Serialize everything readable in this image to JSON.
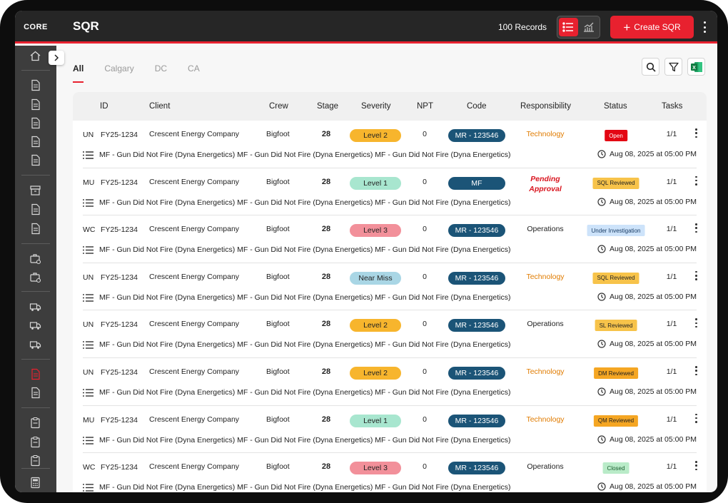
{
  "app": {
    "logo": "CORE",
    "title": "SQR",
    "records": "100 Records",
    "create_label": "Create SQR"
  },
  "colors": {
    "accent": "#e8212f",
    "topbar": "#262626",
    "sidebar": "#3d3d3d",
    "code_pill": "#1b5477"
  },
  "tabs": [
    {
      "label": "All",
      "active": true
    },
    {
      "label": "Calgary",
      "active": false
    },
    {
      "label": "DC",
      "active": false
    },
    {
      "label": "CA",
      "active": false
    }
  ],
  "toolbar": {
    "search_icon": "search-icon",
    "filter_icon": "filter-icon",
    "excel_icon": "excel-export-icon",
    "excel_letter": "X"
  },
  "columns": {
    "id": "ID",
    "client": "Client",
    "crew": "Crew",
    "stage": "Stage",
    "severity": "Severity",
    "npt": "NPT",
    "code": "Code",
    "responsibility": "Responsibility",
    "status": "Status",
    "tasks": "Tasks"
  },
  "rows": [
    {
      "region": "UN",
      "id": "FY25-1234",
      "client": "Crescent Energy Company",
      "crew": "Bigfoot",
      "stage": "28",
      "severity": "Level 2",
      "sev_bg": "#f7b52d",
      "sev_fg": "#222222",
      "npt": "0",
      "code": "MR - 123546",
      "responsibility": "Technology",
      "resp_color": "#e07b00",
      "resp_pending": false,
      "status": "Open",
      "status_bg": "#e30613",
      "status_fg": "#ffffff",
      "tasks": "1/1",
      "description": "MF - Gun Did Not Fire (Dyna Energetics) MF - Gun Did Not Fire (Dyna Energetics) MF - Gun Did Not Fire (Dyna Energetics)",
      "date": "Aug 08, 2025 at 05:00 PM"
    },
    {
      "region": "MU",
      "id": "FY25-1234",
      "client": "Crescent Energy Company",
      "crew": "Bigfoot",
      "stage": "28",
      "severity": "Level 1",
      "sev_bg": "#a8e6cf",
      "sev_fg": "#222222",
      "npt": "0",
      "code": "MF",
      "responsibility_line1": "Pending",
      "responsibility_line2": "Approval",
      "resp_pending": true,
      "status": "SQL Reviewed",
      "status_bg": "#f7c34a",
      "status_fg": "#222222",
      "tasks": "1/1",
      "description": "MF - Gun Did Not Fire (Dyna Energetics) MF - Gun Did Not Fire (Dyna Energetics) MF - Gun Did Not Fire (Dyna Energetics)",
      "date": "Aug 08, 2025 at 05:00 PM"
    },
    {
      "region": "WC",
      "id": "FY25-1234",
      "client": "Crescent Energy Company",
      "crew": "Bigfoot",
      "stage": "28",
      "severity": "Level 3",
      "sev_bg": "#f2909a",
      "sev_fg": "#222222",
      "npt": "0",
      "code": "MR - 123546",
      "responsibility": "Operations",
      "resp_color": "#222222",
      "resp_pending": false,
      "status": "Under Investigation",
      "status_bg": "#cde3fa",
      "status_fg": "#1a3d66",
      "tasks": "1/1",
      "description": "MF - Gun Did Not Fire (Dyna Energetics) MF - Gun Did Not Fire (Dyna Energetics) MF - Gun Did Not Fire (Dyna Energetics)",
      "date": "Aug 08, 2025 at 05:00 PM"
    },
    {
      "region": "UN",
      "id": "FY25-1234",
      "client": "Crescent Energy Company",
      "crew": "Bigfoot",
      "stage": "28",
      "severity": "Near Miss",
      "sev_bg": "#a9d6e5",
      "sev_fg": "#222222",
      "npt": "0",
      "code": "MR - 123546",
      "responsibility": "Technology",
      "resp_color": "#e07b00",
      "resp_pending": false,
      "status": "SQL Reviewed",
      "status_bg": "#f7c34a",
      "status_fg": "#222222",
      "tasks": "1/1",
      "description": "MF - Gun Did Not Fire (Dyna Energetics) MF - Gun Did Not Fire (Dyna Energetics) MF - Gun Did Not Fire (Dyna Energetics)",
      "date": "Aug 08, 2025 at 05:00 PM"
    },
    {
      "region": "UN",
      "id": "FY25-1234",
      "client": "Crescent Energy Company",
      "crew": "Bigfoot",
      "stage": "28",
      "severity": "Level 2",
      "sev_bg": "#f7b52d",
      "sev_fg": "#222222",
      "npt": "0",
      "code": "MR - 123546",
      "responsibility": "Operations",
      "resp_color": "#222222",
      "resp_pending": false,
      "status": "SL Reviewed",
      "status_bg": "#f7c34a",
      "status_fg": "#222222",
      "tasks": "1/1",
      "description": "MF - Gun Did Not Fire (Dyna Energetics) MF - Gun Did Not Fire (Dyna Energetics) MF - Gun Did Not Fire (Dyna Energetics)",
      "date": "Aug 08, 2025 at 05:00 PM"
    },
    {
      "region": "UN",
      "id": "FY25-1234",
      "client": "Crescent Energy Company",
      "crew": "Bigfoot",
      "stage": "28",
      "severity": "Level 2",
      "sev_bg": "#f7b52d",
      "sev_fg": "#222222",
      "npt": "0",
      "code": "MR - 123546",
      "responsibility": "Technology",
      "resp_color": "#e07b00",
      "resp_pending": false,
      "status": "DM Reviewed",
      "status_bg": "#f5a623",
      "status_fg": "#222222",
      "tasks": "1/1",
      "description": "MF - Gun Did Not Fire (Dyna Energetics) MF - Gun Did Not Fire (Dyna Energetics) MF - Gun Did Not Fire (Dyna Energetics)",
      "date": "Aug 08, 2025 at 05:00 PM"
    },
    {
      "region": "MU",
      "id": "FY25-1234",
      "client": "Crescent Energy Company",
      "crew": "Bigfoot",
      "stage": "28",
      "severity": "Level 1",
      "sev_bg": "#a8e6cf",
      "sev_fg": "#222222",
      "npt": "0",
      "code": "MR - 123546",
      "responsibility": "Technology",
      "resp_color": "#e07b00",
      "resp_pending": false,
      "status": "QM Reviewed",
      "status_bg": "#f5a623",
      "status_fg": "#222222",
      "tasks": "1/1",
      "description": "MF - Gun Did Not Fire (Dyna Energetics) MF - Gun Did Not Fire (Dyna Energetics) MF - Gun Did Not Fire (Dyna Energetics)",
      "date": "Aug 08, 2025 at 05:00 PM"
    },
    {
      "region": "WC",
      "id": "FY25-1234",
      "client": "Crescent Energy Company",
      "crew": "Bigfoot",
      "stage": "28",
      "severity": "Level 3",
      "sev_bg": "#f2909a",
      "sev_fg": "#222222",
      "npt": "0",
      "code": "MR - 123546",
      "responsibility": "Operations",
      "resp_color": "#222222",
      "resp_pending": false,
      "status": "Closed",
      "status_bg": "#b9ebc8",
      "status_fg": "#1a5c2e",
      "tasks": "1/1",
      "description": "MF - Gun Did Not Fire (Dyna Energetics) MF - Gun Did Not Fire (Dyna Energetics) MF - Gun Did Not Fire (Dyna Energetics)",
      "date": "Aug 08, 2025 at 05:00 PM"
    }
  ],
  "sidebar": {
    "icons": [
      "home-icon",
      "edit-document-icon",
      "document-icon",
      "settings-document-icon",
      "spreadsheet-icon",
      "checklist-icon",
      "archive-box-icon",
      "document-icon",
      "edit-document-icon",
      "briefcase-settings-icon",
      "briefcase-search-icon",
      "truck-settings-icon",
      "truck-document-icon",
      "truck-group-icon",
      "report-icon",
      "report-icon",
      "clipboard-icon",
      "clipboard-edit-icon",
      "clipboard-check-icon",
      "calculator-icon"
    ]
  }
}
